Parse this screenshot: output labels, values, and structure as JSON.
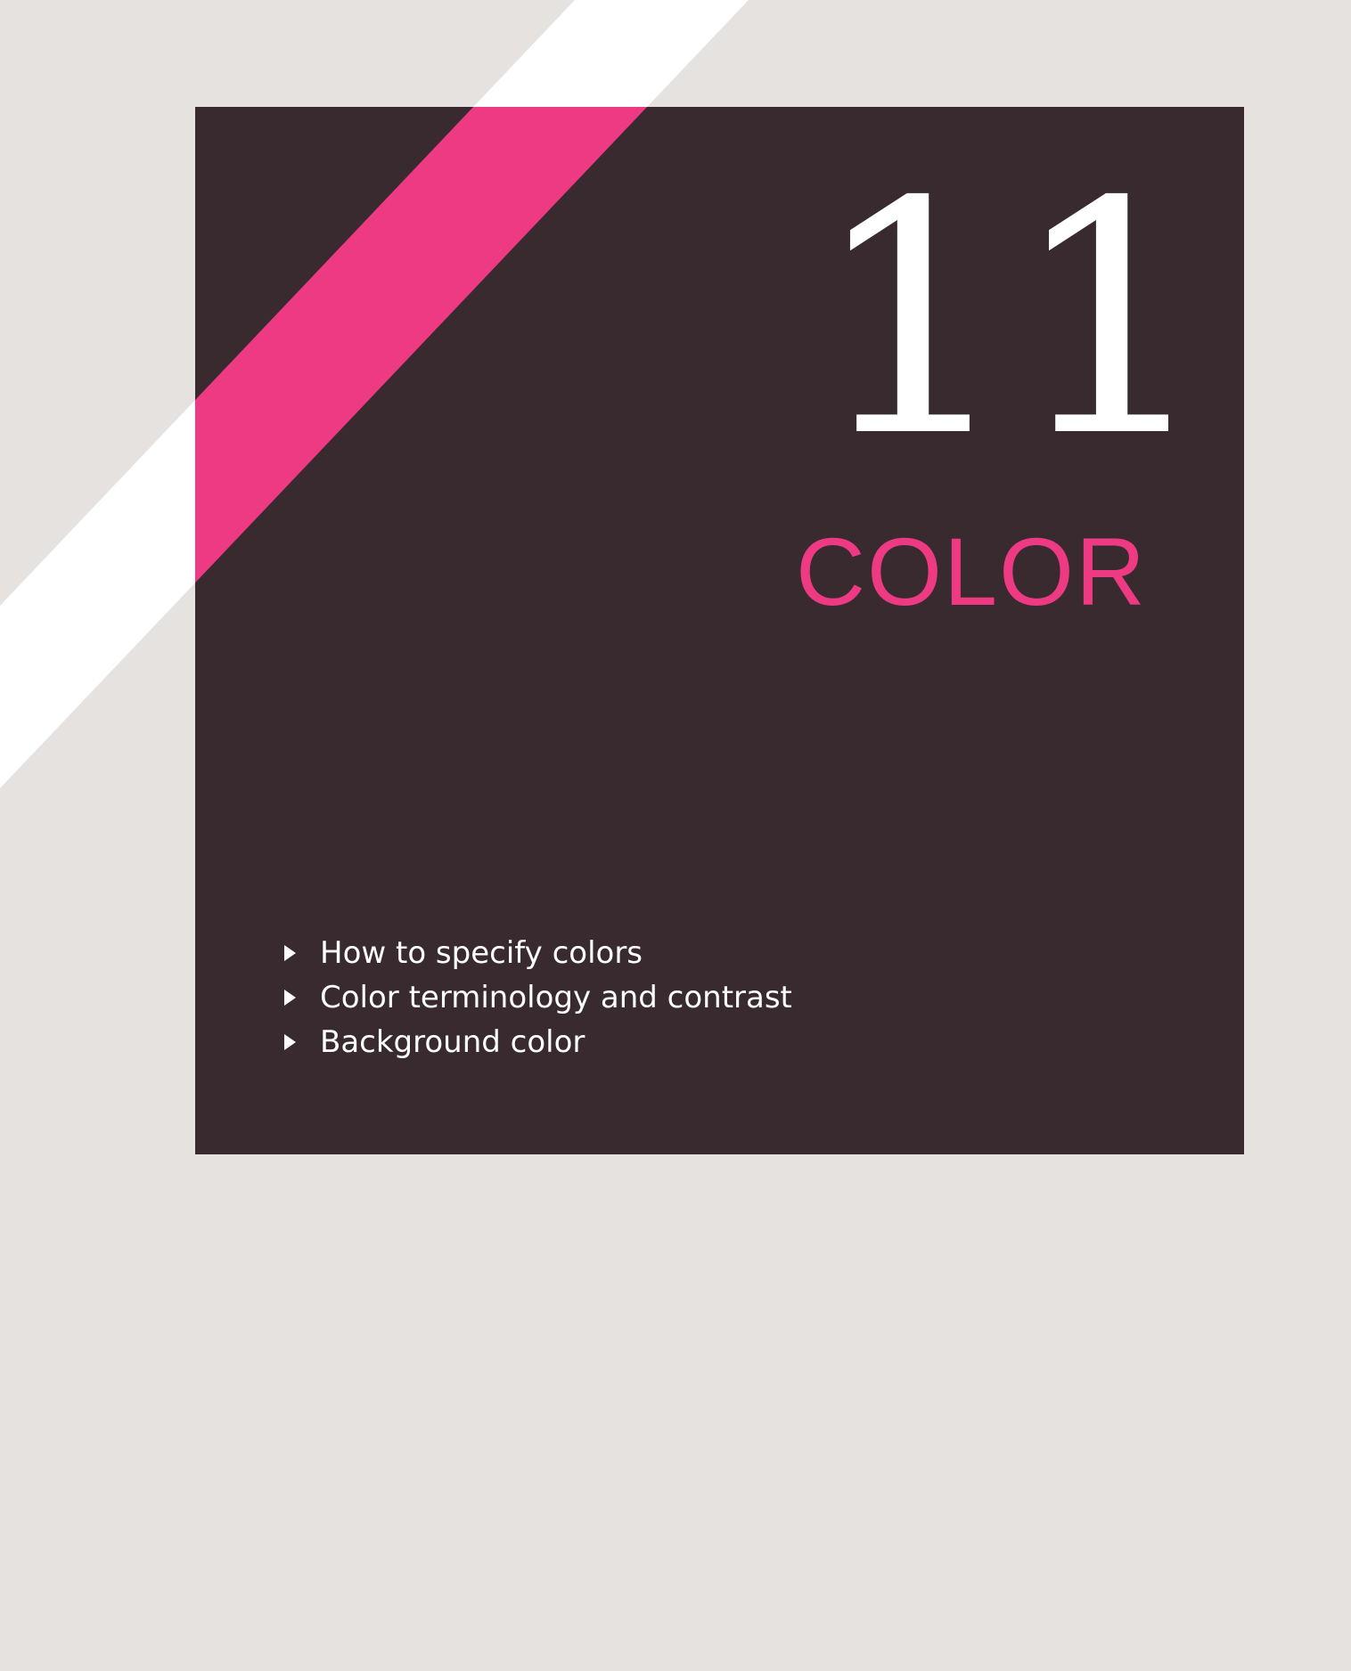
{
  "chapter": {
    "number": "11",
    "title": "COLOR"
  },
  "topics": [
    "How to specify colors",
    "Color terminology and contrast",
    "Background color"
  ],
  "colors": {
    "page_background": "#e5e2df",
    "panel": "#382a2f",
    "accent": "#ee3a82",
    "stripe_light": "#ffffff"
  },
  "icons": {
    "topic_bullet": "triangle-right-icon"
  }
}
